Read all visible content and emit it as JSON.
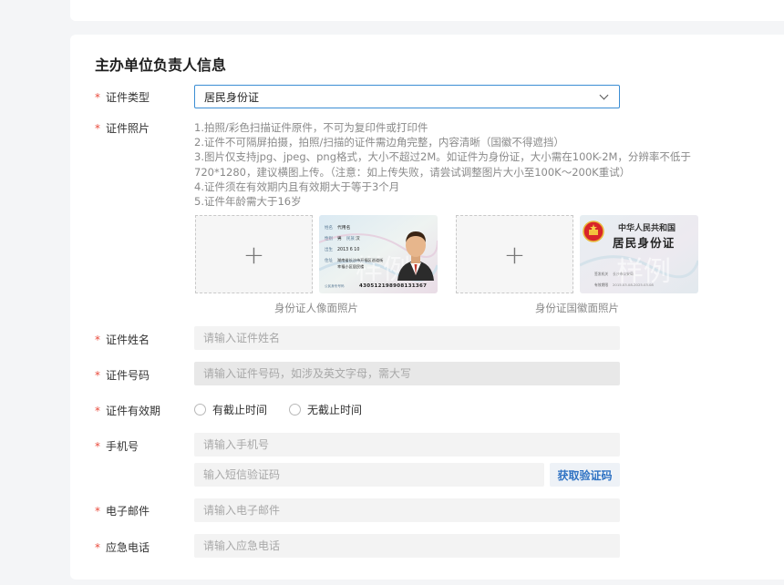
{
  "section": {
    "title": "主办单位负责人信息"
  },
  "fields": {
    "id_type": {
      "label": "证件类型",
      "value": "居民身份证"
    },
    "id_photo": {
      "label": "证件照片",
      "notes": [
        "1.拍照/彩色扫描证件原件，不可为复印件或打印件",
        "2.证件不可隔屏拍摄，拍照/扫描的证件需边角完整，内容清晰（国徽不得遮挡）",
        "3.图片仅支持jpg、jpeg、png格式，大小不超过2M。如证件为身份证，大小需在100K-2M，分辨率不低于",
        "720*1280，建议横图上传。（注意：如上传失败，请尝试调整图片大小至100K～200K重试）",
        "4.证件须在有效期内且有效期大于等于3个月",
        "5.证件年龄需大于16岁"
      ],
      "front_caption": "身份证人像面照片",
      "back_caption": "身份证国徽面照片",
      "upload_symbol": "+",
      "sample_front": {
        "name_label": "姓名",
        "name_value": "代用名",
        "sex_label": "性别",
        "sex_value": "男",
        "ethnic_label": "民族",
        "ethnic_value": "汉",
        "birth_label": "出生",
        "birth_value": "2013   6   10",
        "address_label": "住址",
        "address_line1": "湖南省长沙市开福区巡道街",
        "address_line2": "幸福小区居民楼",
        "id_label": "公民身份号码",
        "id_number": "430512198908131367",
        "watermark": "样例"
      },
      "sample_back": {
        "country": "中华人民共和国",
        "card_title": "居民身份证",
        "authority_label": "签发机关",
        "authority_value": "长沙市公安局",
        "validity_label": "有效期限",
        "validity_value": "2015.03.08-2025.03.08",
        "watermark": "样例"
      }
    },
    "name": {
      "label": "证件姓名",
      "placeholder": "请输入证件姓名"
    },
    "id_number": {
      "label": "证件号码",
      "placeholder": "请输入证件号码，如涉及英文字母，需大写"
    },
    "validity": {
      "label": "证件有效期",
      "options": [
        "有截止时间",
        "无截止时间"
      ]
    },
    "phone": {
      "label": "手机号",
      "placeholder": "请输入手机号",
      "code_placeholder": "输入短信验证码",
      "code_button": "获取验证码"
    },
    "email": {
      "label": "电子邮件",
      "placeholder": "请输入电子邮件"
    },
    "emergency": {
      "label": "应急电话",
      "placeholder": "请输入应急电话"
    }
  },
  "required_mark": "*",
  "colors": {
    "accent": "#3b8ed4",
    "required": "#e94b3c",
    "link": "#2f72c3"
  }
}
